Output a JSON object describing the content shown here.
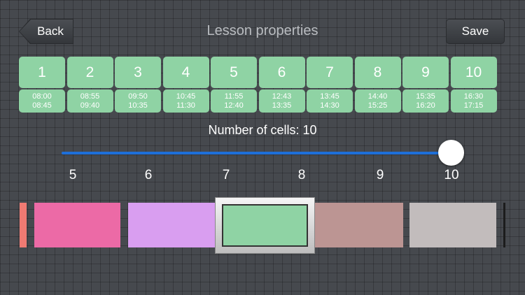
{
  "nav": {
    "back_label": "Back",
    "title": "Lesson properties",
    "save_label": "Save"
  },
  "lessons": [
    {
      "number": "1",
      "start": "08:00",
      "end": "08:45"
    },
    {
      "number": "2",
      "start": "08:55",
      "end": "09:40"
    },
    {
      "number": "3",
      "start": "09:50",
      "end": "10:35"
    },
    {
      "number": "4",
      "start": "10:45",
      "end": "11:30"
    },
    {
      "number": "5",
      "start": "11:55",
      "end": "12:40"
    },
    {
      "number": "6",
      "start": "12:43",
      "end": "13:35"
    },
    {
      "number": "7",
      "start": "13:45",
      "end": "14:30"
    },
    {
      "number": "8",
      "start": "14:40",
      "end": "15:25"
    },
    {
      "number": "9",
      "start": "15:35",
      "end": "16:20"
    },
    {
      "number": "10",
      "start": "16:30",
      "end": "17:15"
    }
  ],
  "cells_setting": {
    "label": "Number of cells: 10",
    "value": 10,
    "ticks": [
      "5",
      "6",
      "7",
      "8",
      "9",
      "10"
    ]
  },
  "colors": {
    "cell": "#8fd3a4",
    "slider": "#1e6fd9",
    "swatches": [
      "#f07a72",
      "#ec6aa6",
      "#d99ef0",
      "#8fd3a4",
      "#bc9593",
      "#c2bcbc"
    ],
    "selected": "#8fd3a4"
  }
}
